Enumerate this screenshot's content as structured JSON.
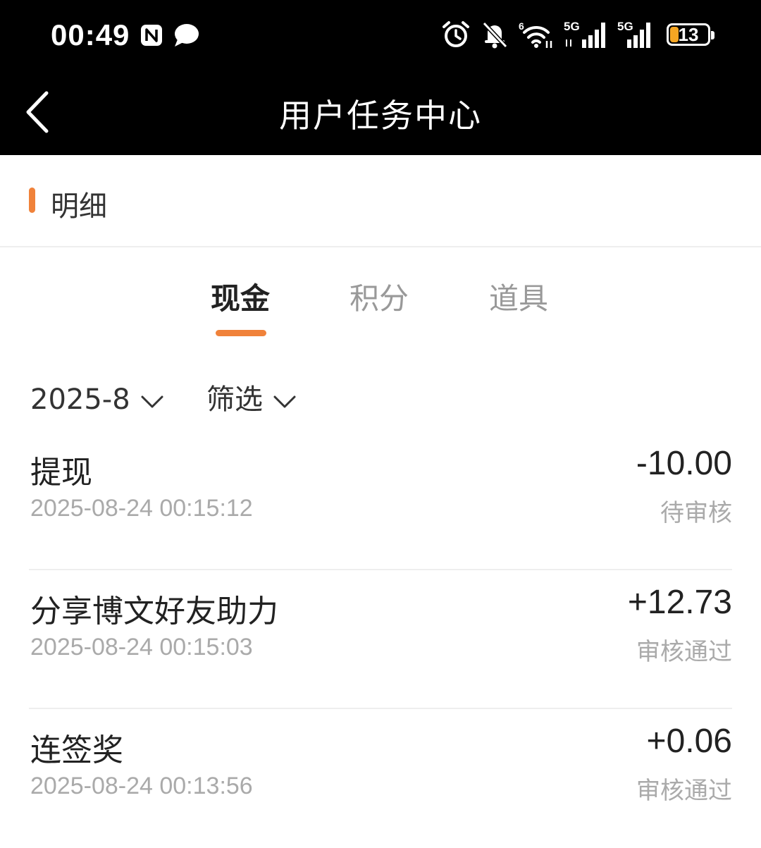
{
  "status_bar": {
    "time": "00:49",
    "battery_level": "13",
    "network_1": "5G",
    "network_2": "5G",
    "wifi_label": "6"
  },
  "nav": {
    "title": "用户任务中心"
  },
  "section": {
    "title": "明细"
  },
  "tabs": [
    {
      "label": "现金",
      "active": true
    },
    {
      "label": "积分",
      "active": false
    },
    {
      "label": "道具",
      "active": false
    }
  ],
  "filters": {
    "month": "2025-8",
    "filter": "筛选"
  },
  "records": [
    {
      "title": "提现",
      "time": "2025-08-24 00:15:12",
      "amount": "-10.00",
      "status": "待审核"
    },
    {
      "title": "分享博文好友助力",
      "time": "2025-08-24 00:15:03",
      "amount": "+12.73",
      "status": "审核通过"
    },
    {
      "title": "连签奖",
      "time": "2025-08-24 00:13:56",
      "amount": "+0.06",
      "status": "审核通过"
    }
  ],
  "colors": {
    "accent": "#f0823a",
    "bar_background": "#000000",
    "muted_text": "#aaaaaa"
  }
}
